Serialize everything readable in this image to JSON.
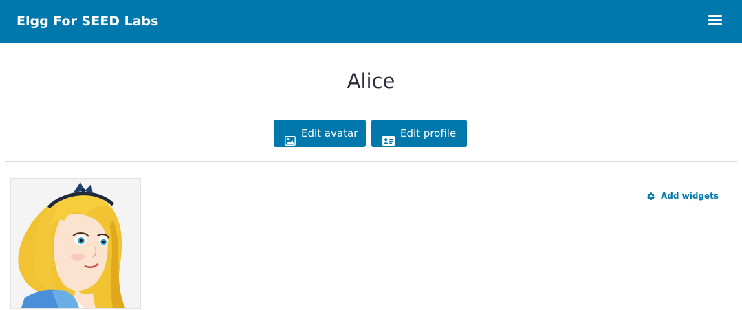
{
  "header": {
    "site_title": "Elgg For SEED Labs",
    "menu_icon": "hamburger-icon",
    "color": "#0078ac"
  },
  "profile": {
    "name": "Alice",
    "avatar_alt": "Alice avatar"
  },
  "actions": {
    "edit_avatar_label": "Edit avatar",
    "edit_avatar_icon": "image-icon",
    "edit_profile_label": "Edit profile",
    "edit_profile_icon": "id-card-icon"
  },
  "widgets": {
    "add_label": "Add widgets",
    "add_icon": "gear-icon"
  }
}
